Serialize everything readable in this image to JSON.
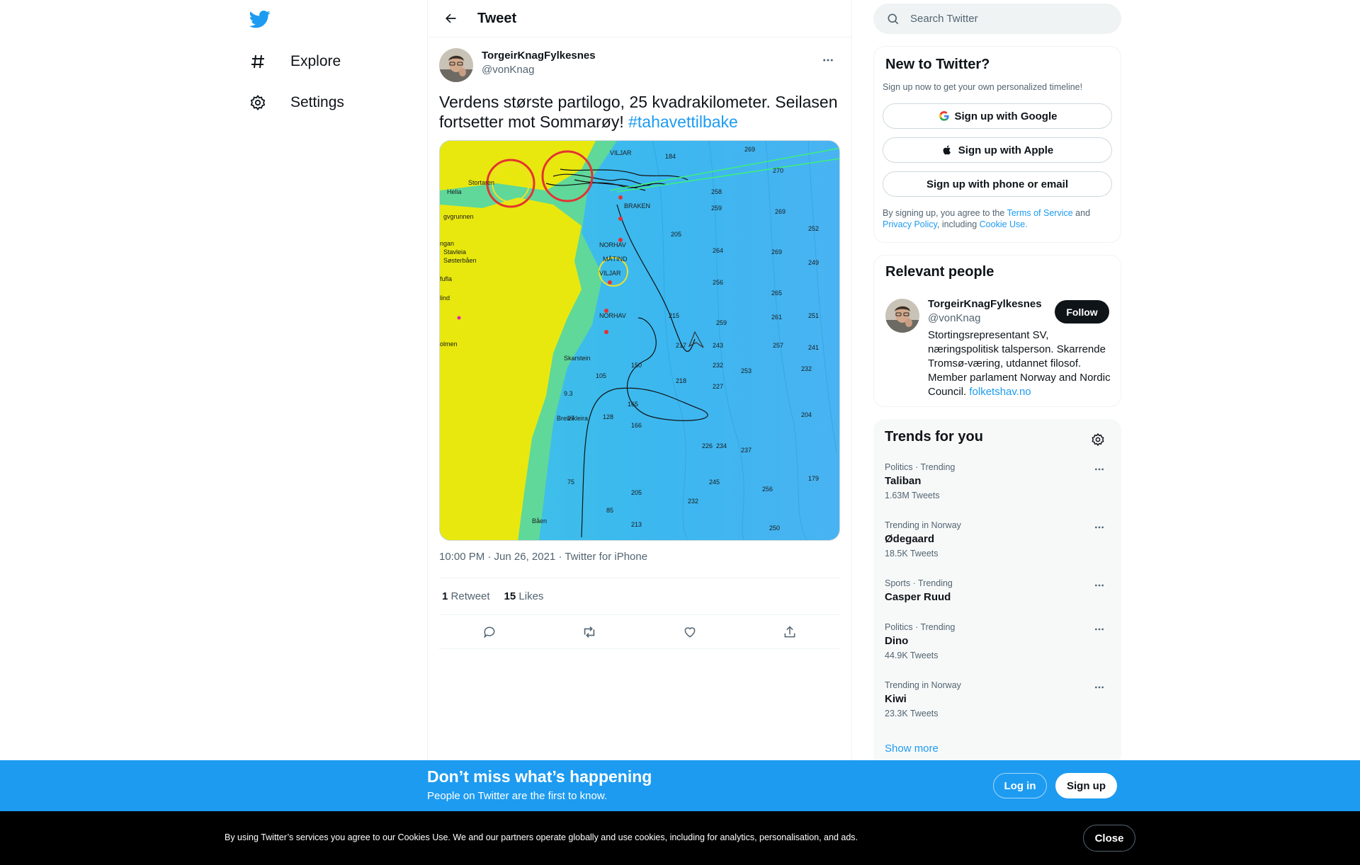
{
  "nav": {
    "items": [
      {
        "label": "Explore",
        "icon": "hashtag-icon"
      },
      {
        "label": "Settings",
        "icon": "gear-icon"
      }
    ]
  },
  "header": {
    "title": "Tweet"
  },
  "tweet": {
    "author_name": "TorgeirKnagFylkesnes",
    "author_handle": "@vonKnag",
    "text": "Verdens største partilogo, 25 kvadrakilometer. Seilasen fortsetter mot Sommarøy! ",
    "hashtag": "#tahavettilbake",
    "timestamp": "10:00 PM · Jun 26, 2021",
    "separator": " · ",
    "source": "Twitter for iPhone",
    "retweets_count": "1",
    "retweets_label": "Retweet",
    "likes_count": "15",
    "likes_label": "Likes"
  },
  "search": {
    "placeholder": "Search Twitter"
  },
  "signup_card": {
    "title": "New to Twitter?",
    "subtitle": "Sign up now to get your own personalized timeline!",
    "google": "Sign up with Google",
    "apple": "Sign up with Apple",
    "phone": "Sign up with phone or email",
    "legal_prefix": "By signing up, you agree to the ",
    "terms": "Terms of Service",
    "and": " and ",
    "privacy": "Privacy Policy",
    "including": ", including ",
    "cookie": "Cookie Use."
  },
  "relevant": {
    "title": "Relevant people",
    "name": "TorgeirKnagFylkesnes",
    "handle": "@vonKnag",
    "follow": "Follow",
    "bio": "Stortingsrepresentant SV, næringspolitisk talsperson. Skarrende Tromsø-væring, utdannet filosof. Member parlament Norway and Nordic Council. ",
    "link": "folketshav.no"
  },
  "trends": {
    "title": "Trends for you",
    "items": [
      {
        "category": "Politics · Trending",
        "name": "Taliban",
        "count": "1.63M Tweets"
      },
      {
        "category": "Trending in Norway",
        "name": "Ødegaard",
        "count": "18.5K Tweets"
      },
      {
        "category": "Sports · Trending",
        "name": "Casper Ruud",
        "count": ""
      },
      {
        "category": "Politics · Trending",
        "name": "Dino",
        "count": "44.9K Tweets"
      },
      {
        "category": "Trending in Norway",
        "name": "Kiwi",
        "count": "23.3K Tweets"
      }
    ],
    "show_more": "Show more"
  },
  "promo": {
    "title": "Don’t miss what’s happening",
    "subtitle": "People on Twitter are the first to know.",
    "login": "Log in",
    "signup": "Sign up"
  },
  "cookie": {
    "text": "By using Twitter’s services you agree to our Cookies Use. We and our partners operate globally and use cookies, including for analytics, personalisation, and ads.",
    "close": "Close"
  },
  "colors": {
    "accent": "#1d9bf0",
    "text": "#0f1419",
    "muted": "#536471",
    "cookie_bg": "#000000"
  }
}
